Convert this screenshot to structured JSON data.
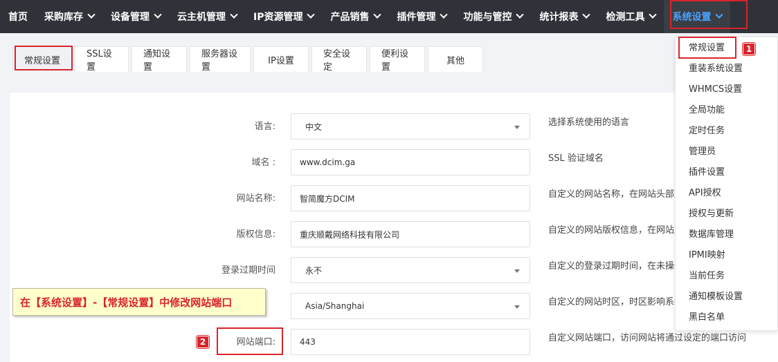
{
  "nav": {
    "items": [
      {
        "label": "首页",
        "has_menu": false
      },
      {
        "label": "采购库存",
        "has_menu": true
      },
      {
        "label": "设备管理",
        "has_menu": true
      },
      {
        "label": "云主机管理",
        "has_menu": true
      },
      {
        "label": "IP资源管理",
        "has_menu": true
      },
      {
        "label": "产品销售",
        "has_menu": true
      },
      {
        "label": "插件管理",
        "has_menu": true
      },
      {
        "label": "功能与管控",
        "has_menu": true
      },
      {
        "label": "统计报表",
        "has_menu": true
      },
      {
        "label": "检测工具",
        "has_menu": true
      },
      {
        "label": "系统设置",
        "has_menu": true,
        "active": true
      }
    ]
  },
  "tabs": [
    {
      "label": "常规设置",
      "active": true
    },
    {
      "label": "SSL设置"
    },
    {
      "label": "通知设置"
    },
    {
      "label": "服务器设置"
    },
    {
      "label": "IP设置"
    },
    {
      "label": "安全设定"
    },
    {
      "label": "便利设置"
    },
    {
      "label": "其他"
    }
  ],
  "form": [
    {
      "label": "语言:",
      "value": "中文",
      "type": "select",
      "help": "选择系统使用的语言"
    },
    {
      "label": "域名 :",
      "value": "www.dcim.ga",
      "type": "input",
      "help": "SSL 验证域名"
    },
    {
      "label": "网站名称:",
      "value": "智简魔方DCIM",
      "type": "input",
      "help": "自定义的网站名称，在网站头部显示"
    },
    {
      "label": "版权信息:",
      "value": "重庆顺戴网络科技有限公司",
      "type": "input",
      "help": "自定义的网站版权信息，在网站底部显示"
    },
    {
      "label": "登录过期时间",
      "value": "永不",
      "type": "select",
      "help": "自定义的登录过期时间，在未操作指定时间后退出登录"
    },
    {
      "label": "",
      "value": "Asia/Shanghai",
      "type": "select",
      "help": "自定义的网站时区，时区影响系统时间显示"
    },
    {
      "label": "网站端口:",
      "value": "443",
      "type": "input",
      "help": "自定义网站端口，访问网站将通过设定的端口访问"
    }
  ],
  "dropdown": {
    "items": [
      "常规设置",
      "重装系统设置",
      "WHMCS设置",
      "全局功能",
      "定时任务",
      "管理员",
      "插件设置",
      "API授权",
      "授权与更新",
      "数据库管理",
      "IPMI映射",
      "当前任务",
      "通知模板设置",
      "黑白名单"
    ]
  },
  "annotations": {
    "badge1": "1",
    "badge2": "2",
    "note": "在【系统设置】-【常规设置】中修改网站端口"
  },
  "colors": {
    "nav_bg": "#2f3238",
    "accent": "#4aa3ff",
    "annotation_red": "#d9232b",
    "note_bg": "#ffffcc"
  }
}
